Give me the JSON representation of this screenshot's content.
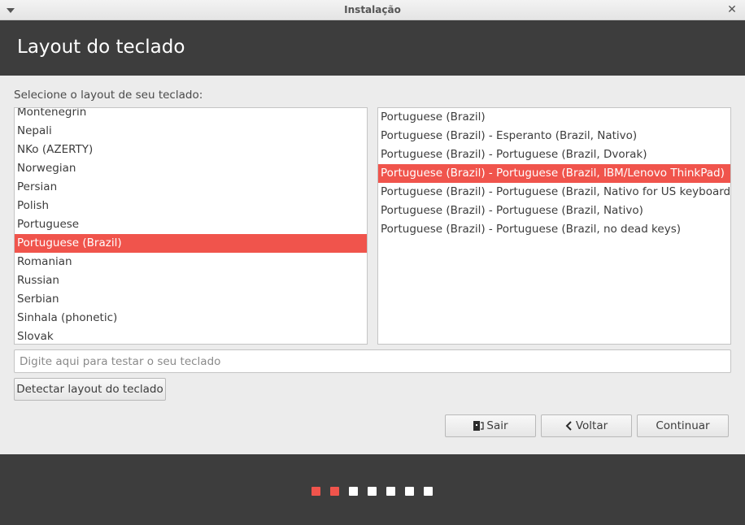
{
  "window": {
    "title": "Instalação",
    "menu_icon": "chevron-down-icon",
    "close_icon": "close-icon"
  },
  "header": {
    "title": "Layout do teclado"
  },
  "prompt": "Selecione o layout de seu teclado:",
  "layouts": {
    "items": [
      "Montenegrin",
      "Nepali",
      "NKo (AZERTY)",
      "Norwegian",
      "Persian",
      "Polish",
      "Portuguese",
      "Portuguese (Brazil)",
      "Romanian",
      "Russian",
      "Serbian",
      "Sinhala (phonetic)",
      "Slovak"
    ],
    "selected": "Portuguese (Brazil)"
  },
  "variants": {
    "items": [
      "Portuguese (Brazil)",
      "Portuguese (Brazil) - Esperanto (Brazil, Nativo)",
      "Portuguese (Brazil) - Portuguese (Brazil, Dvorak)",
      "Portuguese (Brazil) - Portuguese (Brazil, IBM/Lenovo ThinkPad)",
      "Portuguese (Brazil) - Portuguese (Brazil, Nativo for US keyboards)",
      "Portuguese (Brazil) - Portuguese (Brazil, Nativo)",
      "Portuguese (Brazil) - Portuguese (Brazil, no dead keys)"
    ],
    "selected": "Portuguese (Brazil) - Portuguese (Brazil, IBM/Lenovo ThinkPad)"
  },
  "test_field": {
    "value": "",
    "placeholder": "Digite aqui para testar o seu teclado"
  },
  "buttons": {
    "detect": "Detectar layout do teclado",
    "quit": "Sair",
    "quit_icon": "exit-door-icon",
    "back": "Voltar",
    "back_icon": "chevron-left-icon",
    "continue": "Continuar"
  },
  "progress": {
    "total_steps": 7,
    "completed_steps": 2
  },
  "colors": {
    "accent": "#f0544c",
    "header_bg": "#3d3d3d",
    "window_bg": "#ececec"
  }
}
